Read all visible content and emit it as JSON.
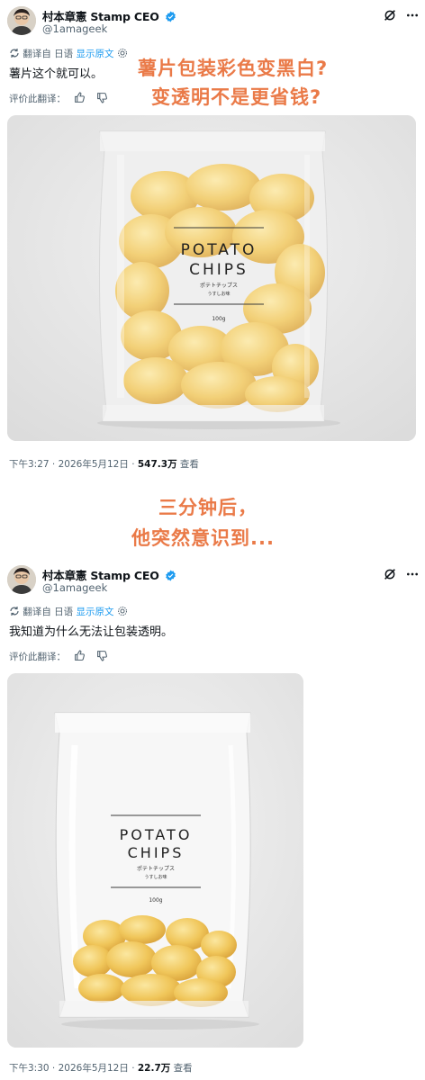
{
  "tweet1": {
    "author_name": "村本章憲 Stamp CEO",
    "handle": "@1amageek",
    "translated_from": "翻译自 日语",
    "show_original": "显示原文",
    "text": "薯片这个就可以。",
    "rate_translation": "评价此翻译：",
    "time_date": "下午3:27 · 2026年5月12日 · ",
    "views": "547.3万",
    "views_label": " 查看",
    "overlay_line1": "薯片包装彩色变黑白?",
    "overlay_line2": "变透明不是更省钱?",
    "package_title_1": "POTATO",
    "package_title_2": "CHIPS",
    "package_sub_jp": "ポテトチップス",
    "package_sub_flavor": "うすしお味",
    "package_weight": "100g",
    "chips_fill_fraction": 0.95
  },
  "caption": {
    "line1": "三分钟后，",
    "line2": "他突然意识到..."
  },
  "tweet2": {
    "author_name": "村本章憲 Stamp CEO",
    "handle": "@1amageek",
    "translated_from": "翻译自 日语",
    "show_original": "显示原文",
    "text": "我知道为什么无法让包装透明。",
    "rate_translation": "评价此翻译：",
    "time_date": "下午3:30 · 2026年5月12日 · ",
    "views": "22.7万",
    "views_label": " 查看",
    "package_title_1": "POTATO",
    "package_title_2": "CHIPS",
    "package_sub_jp": "ポテトチップス",
    "package_sub_flavor": "うすしお味",
    "package_weight": "100g",
    "chips_fill_fraction": 0.35
  },
  "colors": {
    "accent_blue": "#1d9bf0",
    "overlay_orange": "#ea7a48",
    "muted": "#536471"
  },
  "icons": [
    "verified-badge-icon",
    "grok-icon",
    "more-icon",
    "translate-icon",
    "gear-icon",
    "thumbs-up-icon",
    "thumbs-down-icon"
  ]
}
